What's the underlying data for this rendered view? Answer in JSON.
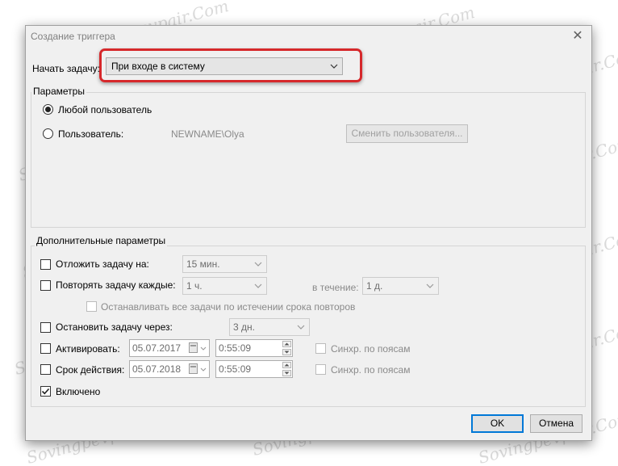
{
  "window": {
    "title": "Создание триггера",
    "close_glyph": "✕"
  },
  "begin_task": {
    "label": "Начать задачу:",
    "value": "При входе в систему"
  },
  "params": {
    "title": "Параметры",
    "any_user_label": "Любой пользователь",
    "any_user_selected": true,
    "user_label": "Пользователь:",
    "user_name": "NEWNAME\\Olya",
    "change_user_label": "Сменить пользователя..."
  },
  "advanced": {
    "title": "Дополнительные параметры",
    "delay": {
      "label": "Отложить задачу на:",
      "checked": false,
      "value": "15 мин."
    },
    "repeat": {
      "label": "Повторять задачу каждые:",
      "checked": false,
      "value": "1 ч.",
      "duration_label": "в течение:",
      "duration_value": "1 д."
    },
    "stop_all_label": "Останавливать все задачи по истечении срока повторов",
    "stop_after": {
      "label": "Остановить задачу через:",
      "checked": false,
      "value": "3 дн."
    },
    "activate": {
      "label": "Активировать:",
      "checked": false,
      "date": "05.07.2017",
      "time": "0:55:09",
      "sync_label": "Синхр. по поясам"
    },
    "expire": {
      "label": "Срок действия:",
      "checked": false,
      "date": "05.07.2018",
      "time": "0:55:09",
      "sync_label": "Синхр. по поясам"
    },
    "enabled": {
      "label": "Включено",
      "checked": true
    }
  },
  "buttons": {
    "ok": "OK",
    "cancel": "Отмена"
  },
  "watermark": "Sovingpevpair.Com"
}
